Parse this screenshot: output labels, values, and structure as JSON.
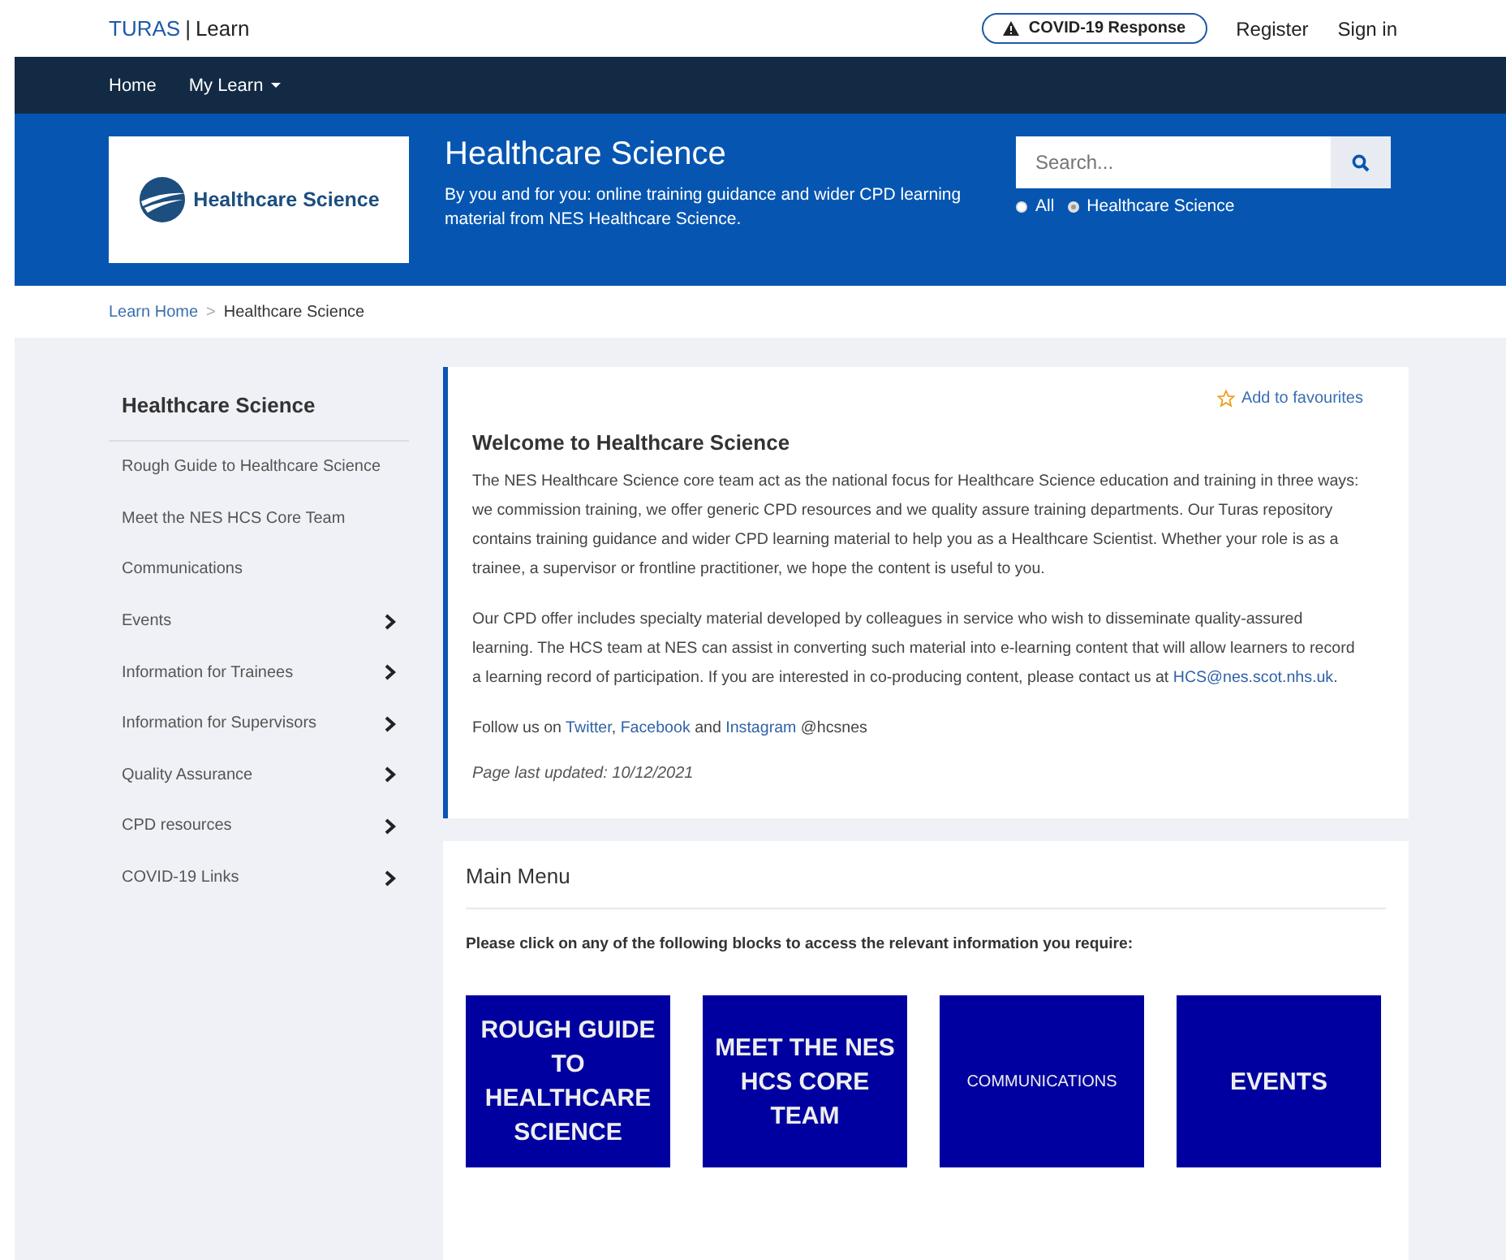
{
  "header": {
    "brand": "TURAS",
    "separator": "|",
    "product": "Learn",
    "alert_button": "COVID-19 Response",
    "links": [
      "Register",
      "Sign in"
    ]
  },
  "nav": [
    {
      "label": "Home",
      "dropdown": false
    },
    {
      "label": "My Learn",
      "dropdown": true
    }
  ],
  "banner": {
    "logo_text": "Healthcare Science",
    "title": "Healthcare Science",
    "subtitle": "By you and for you: online training guidance and wider CPD learning material from NES Healthcare Science.",
    "search": {
      "placeholder": "Search..."
    },
    "scopes": [
      {
        "label": "All",
        "selected": false
      },
      {
        "label": "Healthcare Science",
        "selected": true
      }
    ]
  },
  "breadcrumb": [
    {
      "label": "Learn Home",
      "link": true
    },
    {
      "label": ">",
      "link": false
    },
    {
      "label": "Healthcare Science",
      "link": false
    }
  ],
  "sidebar": {
    "title": "Healthcare Science",
    "items": [
      {
        "label": "Rough Guide to Healthcare Science",
        "expandable": false
      },
      {
        "label": "Meet the NES HCS Core Team",
        "expandable": false
      },
      {
        "label": "Communications",
        "expandable": false
      },
      {
        "label": "Events",
        "expandable": true
      },
      {
        "label": "Information for Trainees",
        "expandable": true
      },
      {
        "label": "Information for Supervisors",
        "expandable": true
      },
      {
        "label": "Quality Assurance",
        "expandable": true
      },
      {
        "label": "CPD resources",
        "expandable": true
      },
      {
        "label": "COVID-19 Links",
        "expandable": true
      }
    ]
  },
  "welcome": {
    "favourite": "Add to favourites",
    "title": "Welcome to Healthcare Science",
    "paragraphs": [
      {
        "lead": "The NES Healthcare Science core team act as the national focus for Healthcare Science education and training in three ways: we commission training, we offer generic CPD resources and we quality assure training departments. Our Turas repository contains training guidance and wider CPD learning material to help you as a Healthcare Scientist. Whether your role is as a trainee, a supervisor or frontline practitioner, we hope the content is useful to you."
      },
      {
        "lead": "Our CPD offer includes specialty material developed by colleagues in service who wish to disseminate quality-assured learning. The HCS team at NES can assist in converting such material into e-learning content that will allow learners to record a learning record of participation. If you are interested in co-producing content, please contact us at ",
        "links": [
          {
            "text": "HCS@nes.scot.nhs.uk",
            "after": "."
          }
        ]
      },
      {
        "lead": "Follow us on ",
        "links": [
          {
            "text": "Twitter",
            "after": ", "
          },
          {
            "text": "Facebook",
            "after": " and "
          },
          {
            "text": "Instagram",
            "after": " @hcsnes"
          }
        ]
      }
    ],
    "updated": "Page last updated: 10/12/2021"
  },
  "main_menu": {
    "title": "Main Menu",
    "instruction": "Please click on any of the following blocks to access the relevant information you require:",
    "blocks": [
      {
        "label": "ROUGH GUIDE TO HEALTHCARE SCIENCE",
        "kind": "standard"
      },
      {
        "label": "MEET THE NES HCS CORE TEAM",
        "kind": "standard"
      },
      {
        "label": "COMMUNICATIONS",
        "kind": "compact"
      },
      {
        "label": "EVENTS",
        "kind": "standard"
      }
    ]
  }
}
